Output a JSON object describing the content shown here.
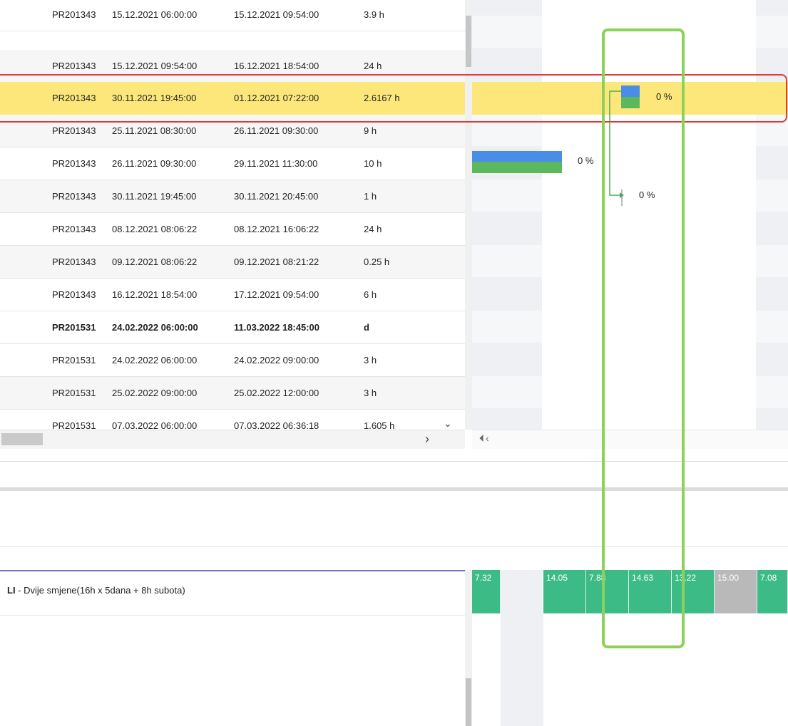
{
  "grid_rows": [
    {
      "code": "PR201343",
      "start": "15.12.2021 06:00:00",
      "end": "15.12.2021 09:54:00",
      "duration": "3.9 h",
      "style": "normal"
    },
    {
      "code": "PR201343",
      "start": "15.12.2021 09:54:00",
      "end": "16.12.2021 18:54:00",
      "duration": "24 h",
      "style": "alt"
    },
    {
      "code": "PR201343",
      "start": "30.11.2021 19:45:00",
      "end": "01.12.2021 07:22:00",
      "duration": "2.6167 h",
      "style": "selected"
    },
    {
      "code": "PR201343",
      "start": "25.11.2021 08:30:00",
      "end": "26.11.2021 09:30:00",
      "duration": "9 h",
      "style": "alt"
    },
    {
      "code": "PR201343",
      "start": "26.11.2021 09:30:00",
      "end": "29.11.2021 11:30:00",
      "duration": "10 h",
      "style": "normal"
    },
    {
      "code": "PR201343",
      "start": "30.11.2021 19:45:00",
      "end": "30.11.2021 20:45:00",
      "duration": "1 h",
      "style": "alt"
    },
    {
      "code": "PR201343",
      "start": "08.12.2021 08:06:22",
      "end": "08.12.2021 16:06:22",
      "duration": "24 h",
      "style": "normal"
    },
    {
      "code": "PR201343",
      "start": "09.12.2021 08:06:22",
      "end": "09.12.2021 08:21:22",
      "duration": "0.25 h",
      "style": "alt"
    },
    {
      "code": "PR201343",
      "start": "16.12.2021 18:54:00",
      "end": "17.12.2021 09:54:00",
      "duration": "6 h",
      "style": "normal"
    },
    {
      "code": "PR201531",
      "start": "24.02.2022 06:00:00",
      "end": "11.03.2022 18:45:00",
      "duration": "d",
      "style": "bold"
    },
    {
      "code": "PR201531",
      "start": "24.02.2022 06:00:00",
      "end": "24.02.2022 09:00:00",
      "duration": "3 h",
      "style": "normal"
    },
    {
      "code": "PR201531",
      "start": "25.02.2022 09:00:00",
      "end": "25.02.2022 12:00:00",
      "duration": "3 h",
      "style": "alt"
    },
    {
      "code": "PR201531",
      "start": "07.03.2022 06:00:00",
      "end": "07.03.2022 06:36:18",
      "duration": "1.605 h",
      "style": "normal"
    }
  ],
  "gantt_labels": {
    "pct_selected": "0 %",
    "pct_row5": "0 %",
    "pct_row6": "0 %"
  },
  "icons": {
    "scroll_down": "⌄",
    "scroll_right": "›",
    "gantt_nav": "⏴‹"
  },
  "resource": {
    "name_prefix": "LI",
    "name_rest": " - Dvije smjene(16h x 5dana + 8h subota)"
  },
  "capacity_cells": [
    {
      "label": "7.32",
      "color": "#3dbb86"
    },
    {
      "label": "",
      "color": "#ffffff"
    },
    {
      "label": "14.05",
      "color": "#3dbb86"
    },
    {
      "label": "7.88",
      "color": "#3dbb86"
    },
    {
      "label": "14.63",
      "color": "#3dbb86"
    },
    {
      "label": "13.22",
      "color": "#3dbb86"
    },
    {
      "label": "15.00",
      "color": "#b9b9b9"
    },
    {
      "label": "7.08",
      "color": "#3dbb86"
    }
  ],
  "colors": {
    "selection": "#fde77b",
    "bar_blue": "#4a8de6",
    "bar_green": "#5cb85c",
    "highlight_red": "#e53935",
    "highlight_green": "#8bd25b"
  }
}
